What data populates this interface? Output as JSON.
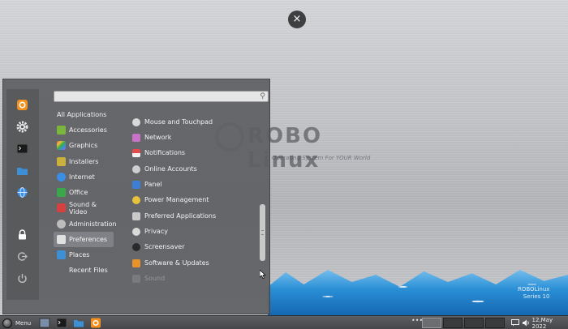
{
  "desktop": {
    "logo_text": "ROBO Linux",
    "logo_tagline": "Operating System For YOUR World",
    "corner_mark": "ROBOLinux\nSeries 10"
  },
  "close_button": {
    "glyph": "×"
  },
  "menu": {
    "search": {
      "value": "",
      "placeholder": ""
    },
    "favorites": [
      {
        "name": "firefox",
        "icon": "firefox-icon",
        "color": "#f4901e"
      },
      {
        "name": "settings",
        "icon": "gear-icon",
        "color": "#e6e6e6"
      },
      {
        "name": "terminal",
        "icon": "terminal-icon",
        "color": "#1a1a1a"
      },
      {
        "name": "files",
        "icon": "folder-icon",
        "color": "#3d8fd6"
      },
      {
        "name": "browser",
        "icon": "globe-icon",
        "color": "#3a8ee6"
      }
    ],
    "session": [
      {
        "name": "lock",
        "icon": "lock-icon"
      },
      {
        "name": "logout",
        "icon": "logout-icon"
      },
      {
        "name": "power",
        "icon": "power-icon"
      }
    ],
    "categories": [
      {
        "label": "All Applications",
        "icon": "",
        "color": ""
      },
      {
        "label": "Accessories",
        "icon": "accessories-icon",
        "color": "#7bb53b"
      },
      {
        "label": "Graphics",
        "icon": "graphics-icon",
        "color": "#d44fa3"
      },
      {
        "label": "Installers",
        "icon": "installers-icon",
        "color": "#c9b23c"
      },
      {
        "label": "Internet",
        "icon": "internet-icon",
        "color": "#3a8ee6"
      },
      {
        "label": "Office",
        "icon": "office-icon",
        "color": "#3aa84a"
      },
      {
        "label": "Sound & Video",
        "icon": "sound-video-icon",
        "color": "#d64040"
      },
      {
        "label": "Administration",
        "icon": "administration-icon",
        "color": "#bdbdbd"
      },
      {
        "label": "Preferences",
        "icon": "preferences-icon",
        "color": "#e0e0e0"
      },
      {
        "label": "Places",
        "icon": "places-icon",
        "color": "#3d8fd6"
      },
      {
        "label": "Recent Files",
        "icon": "",
        "color": ""
      }
    ],
    "selected_category": "Preferences",
    "apps": [
      {
        "label": "",
        "icon": "",
        "color": "",
        "state": "cut"
      },
      {
        "label": "Mouse and Touchpad",
        "icon": "mouse-icon",
        "color": "#d9d9d9",
        "state": "normal"
      },
      {
        "label": "Network",
        "icon": "network-icon",
        "color": "#c873c8",
        "state": "normal"
      },
      {
        "label": "Notifications",
        "icon": "notifications-icon",
        "color": "#e34b4b",
        "state": "normal"
      },
      {
        "label": "Online Accounts",
        "icon": "online-accounts-icon",
        "color": "#cfcfcf",
        "state": "normal"
      },
      {
        "label": "Panel",
        "icon": "panel-icon",
        "color": "#3d7fd6",
        "state": "normal"
      },
      {
        "label": "Power Management",
        "icon": "power-management-icon",
        "color": "#e8c23a",
        "state": "normal"
      },
      {
        "label": "Preferred Applications",
        "icon": "preferred-applications-icon",
        "color": "#c9c9c9",
        "state": "normal"
      },
      {
        "label": "Privacy",
        "icon": "privacy-icon",
        "color": "#d9d9d9",
        "state": "normal"
      },
      {
        "label": "Screensaver",
        "icon": "screensaver-icon",
        "color": "#2a2a2a",
        "state": "normal"
      },
      {
        "label": "Software & Updates",
        "icon": "software-updates-icon",
        "color": "#e8932a",
        "state": "normal"
      },
      {
        "label": "Sound",
        "icon": "sound-icon",
        "color": "#9a9a9a",
        "state": "faded"
      }
    ]
  },
  "taskbar": {
    "menu_label": "Menu",
    "launchers": [
      {
        "name": "show-desktop",
        "icon": "desktop-icon",
        "color": "#7a8ea8"
      },
      {
        "name": "terminal",
        "icon": "terminal-icon",
        "color": "#1a1a1a"
      },
      {
        "name": "files",
        "icon": "folder-icon",
        "color": "#3d8fd6"
      },
      {
        "name": "firefox",
        "icon": "firefox-icon",
        "color": "#f4901e"
      }
    ],
    "overflow": "•••",
    "workspaces": 4,
    "active_workspace": 1,
    "date": "12,May 2022"
  }
}
